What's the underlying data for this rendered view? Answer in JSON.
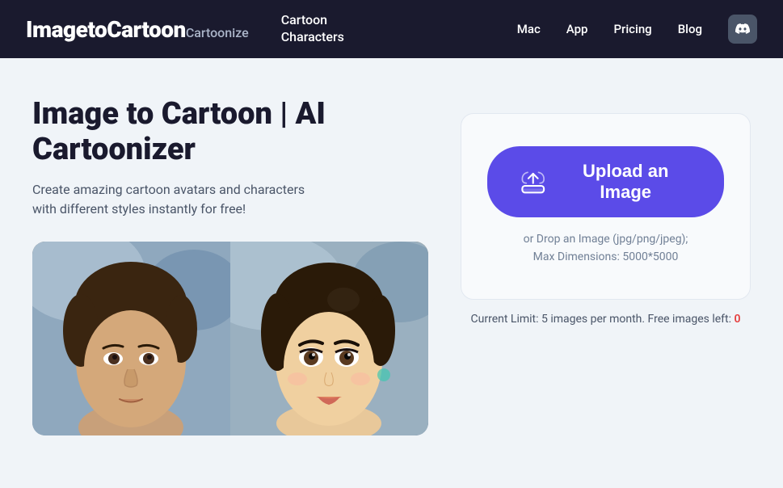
{
  "navbar": {
    "brand_main": "ImagetoCartoon",
    "brand_sub": "Cartoonize",
    "nav_cartoon": "Cartoon",
    "nav_characters": "Characters",
    "links": [
      {
        "label": "Mac",
        "id": "mac"
      },
      {
        "label": "App",
        "id": "app"
      },
      {
        "label": "Pricing",
        "id": "pricing"
      },
      {
        "label": "Blog",
        "id": "blog"
      }
    ],
    "discord_label": "Discord"
  },
  "main": {
    "title_line1": "Image to Cartoon | AI",
    "title_line2": "Cartoonizer",
    "description": "Create amazing cartoon avatars and characters\nwith different styles instantly for free!",
    "upload_button_label": "Upload an Image",
    "drop_info_line1": "or Drop an Image (jpg/png/jpeg);",
    "drop_info_line2": "Max Dimensions: 5000*5000",
    "limit_text": "Current Limit: 5 images per month. Free images left:",
    "limit_count": "0"
  }
}
